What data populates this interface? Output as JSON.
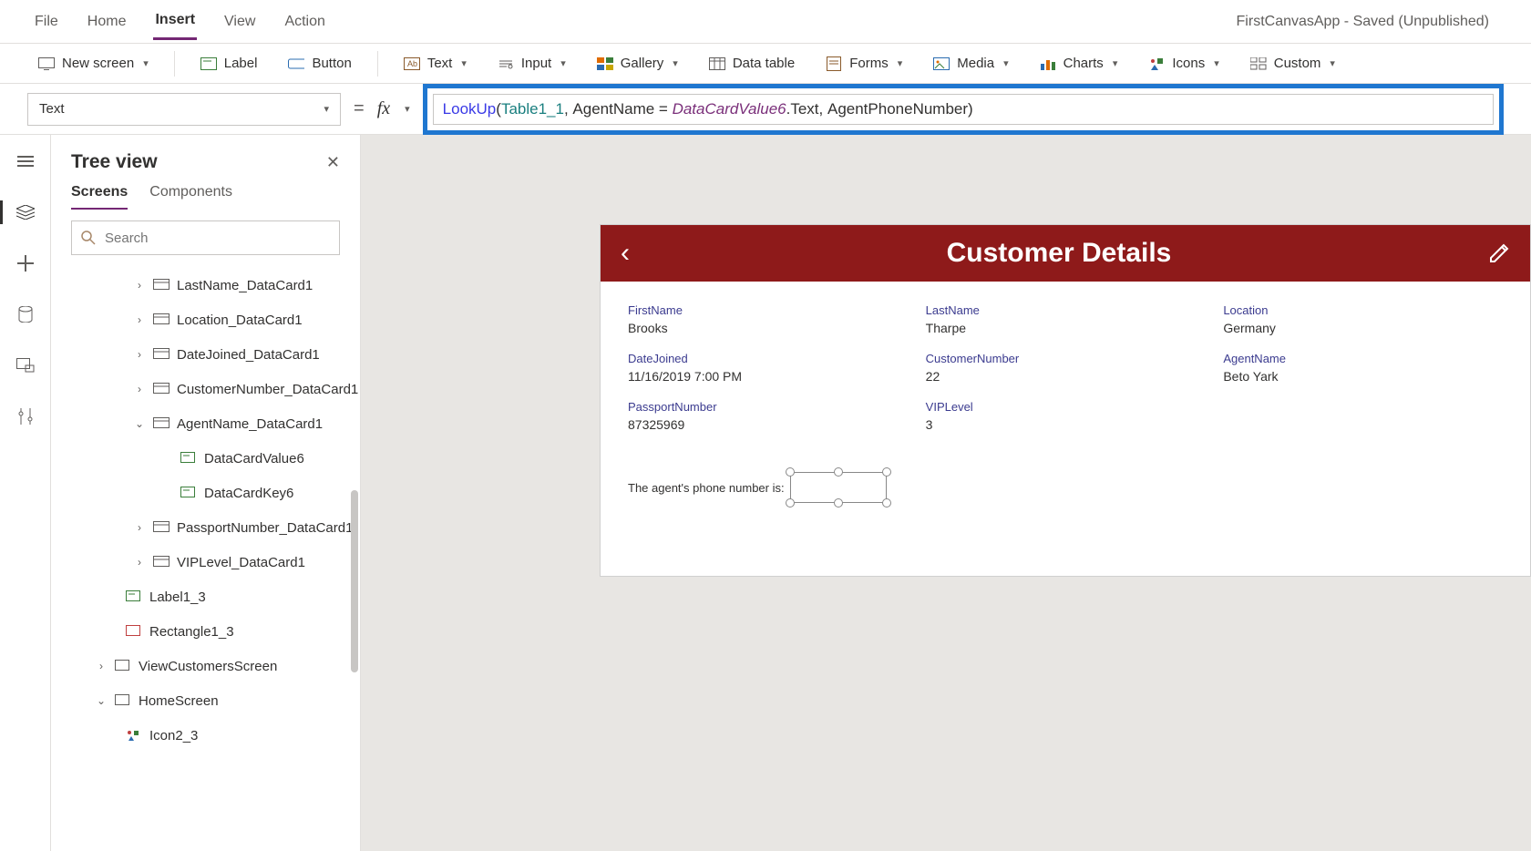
{
  "window_title": "FirstCanvasApp - Saved (Unpublished)",
  "menu": {
    "file": "File",
    "home": "Home",
    "insert": "Insert",
    "view": "View",
    "action": "Action"
  },
  "ribbon": {
    "new_screen": "New screen",
    "label": "Label",
    "button": "Button",
    "text": "Text",
    "input": "Input",
    "gallery": "Gallery",
    "data_table": "Data table",
    "forms": "Forms",
    "media": "Media",
    "charts": "Charts",
    "icons": "Icons",
    "custom": "Custom"
  },
  "property_selected": "Text",
  "formula": {
    "fn": "LookUp",
    "open": "(",
    "id1": "Table1_1",
    "c1": ", ",
    "p1": "AgentName = ",
    "it": "DataCardValue6",
    "p2": ".Text, ",
    "p3": "AgentPhoneNumber",
    "close": ")"
  },
  "tree": {
    "title": "Tree view",
    "tab_screens": "Screens",
    "tab_components": "Components",
    "search_placeholder": "Search",
    "items": {
      "lastname": "LastName_DataCard1",
      "location": "Location_DataCard1",
      "datejoined": "DateJoined_DataCard1",
      "custnum": "CustomerNumber_DataCard1",
      "agentname": "AgentName_DataCard1",
      "dcv6": "DataCardValue6",
      "dck6": "DataCardKey6",
      "passport": "PassportNumber_DataCard1",
      "viplevel": "VIPLevel_DataCard1",
      "label13": "Label1_3",
      "rect13": "Rectangle1_3",
      "viewcust": "ViewCustomersScreen",
      "homescreen": "HomeScreen",
      "icon23": "Icon2_3"
    }
  },
  "preview": {
    "title": "Customer Details",
    "fields": {
      "firstname_l": "FirstName",
      "firstname_v": "Brooks",
      "lastname_l": "LastName",
      "lastname_v": "Tharpe",
      "location_l": "Location",
      "location_v": "Germany",
      "datejoined_l": "DateJoined",
      "datejoined_v": "11/16/2019 7:00 PM",
      "custnum_l": "CustomerNumber",
      "custnum_v": "22",
      "agentname_l": "AgentName",
      "agentname_v": "Beto Yark",
      "passport_l": "PassportNumber",
      "passport_v": "87325969",
      "viplevel_l": "VIPLevel",
      "viplevel_v": "3"
    },
    "agent_phone_label": "The agent's phone number is:"
  }
}
